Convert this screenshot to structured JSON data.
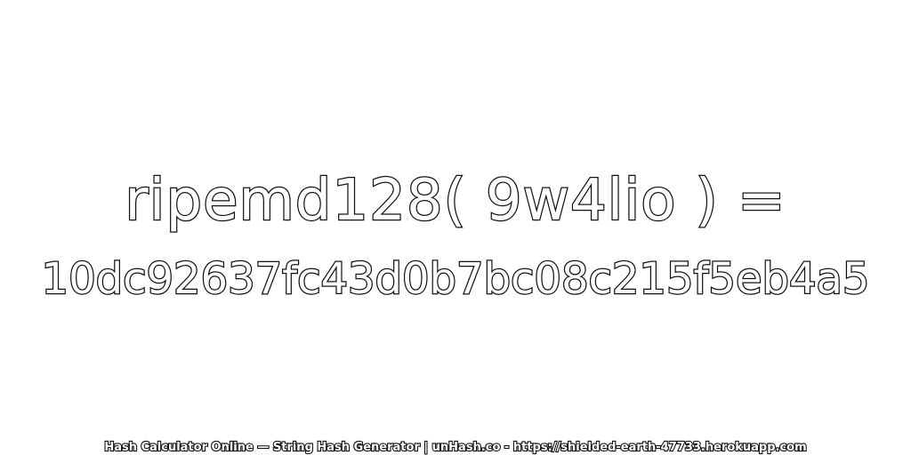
{
  "expression": "ripemd128( 9w4lio ) =",
  "hash": "10dc92637fc43d0b7bc08c215f5eb4a5",
  "footer": "Hash Calculator Online — String Hash Generator | unHash.co - https://shielded-earth-47733.herokuapp.com",
  "colors": {
    "background": "#ffffff",
    "text_fill": "#ffffff",
    "text_outline": "#111111"
  }
}
